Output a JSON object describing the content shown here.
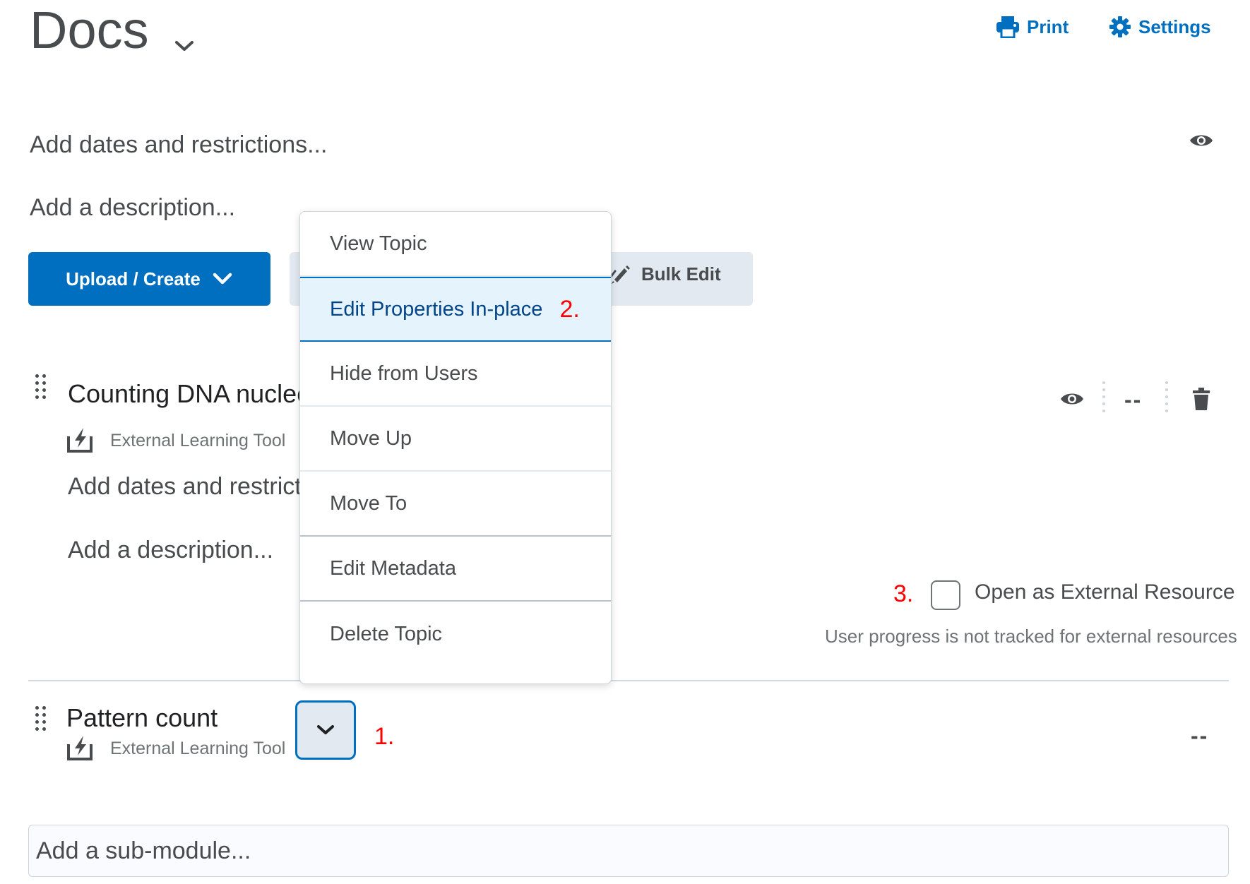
{
  "header": {
    "title": "Docs",
    "print_label": "Print",
    "settings_label": "Settings"
  },
  "module": {
    "add_dates": "Add dates and restrictions...",
    "add_description": "Add a description...",
    "upload_label": "Upload / Create",
    "bulk_edit_label": "Bulk Edit"
  },
  "topics": [
    {
      "title": "Counting DNA nucleo",
      "type": "External Learning Tool",
      "add_dates": "Add dates and restrict",
      "add_description": "Add a description...",
      "grade": "--",
      "external_step": "3.",
      "external_label": "Open as External Resource",
      "external_note": "User progress is not tracked for external resources"
    },
    {
      "title": "Pattern count",
      "type": "External Learning Tool",
      "grade": "--",
      "step": "1."
    }
  ],
  "menu": {
    "items": [
      {
        "label": "View Topic"
      },
      {
        "label": "Edit Properties In-place",
        "step": "2."
      },
      {
        "label": "Hide from Users"
      },
      {
        "label": "Move Up"
      },
      {
        "label": "Move To"
      },
      {
        "label": "Edit Metadata"
      },
      {
        "label": "Delete Topic"
      }
    ]
  },
  "submodule_placeholder": "Add a sub-module...",
  "colors": {
    "accent": "#006fbf",
    "highlight": "#e5f4fc",
    "annotation": "#ff0000"
  }
}
